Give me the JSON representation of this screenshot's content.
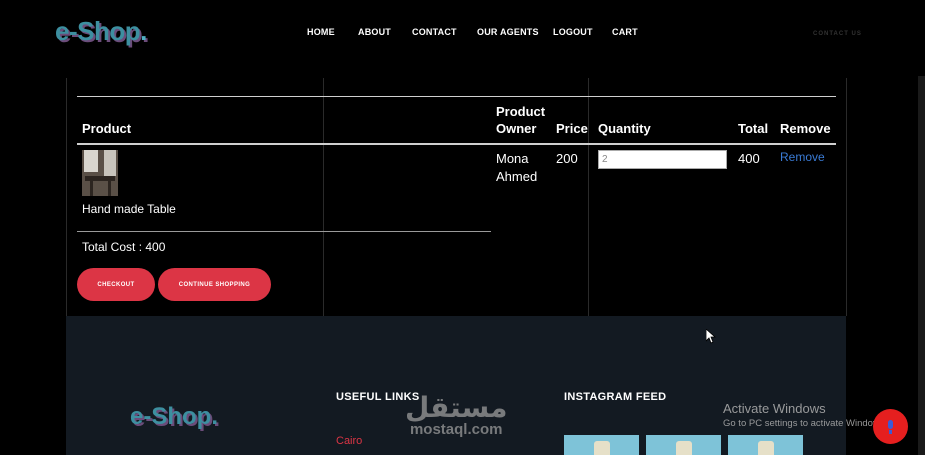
{
  "brand": {
    "logo_text": "e-Shop",
    "logo_dot": "."
  },
  "nav": {
    "items": [
      {
        "label": "HOME"
      },
      {
        "label": "ABOUT"
      },
      {
        "label": "CONTACT"
      },
      {
        "label": "OUR AGENTS"
      },
      {
        "label": "LOGOUT"
      },
      {
        "label": "CART"
      }
    ],
    "contact_us": "CONTACT US"
  },
  "cart": {
    "headers": {
      "product": "Product",
      "owner": "Product Owner",
      "price": "Price",
      "quantity": "Quantity",
      "total": "Total",
      "remove": "Remove"
    },
    "rows": [
      {
        "product_name": "Hand made Table",
        "owner": "Mona Ahmed",
        "price": "200",
        "quantity": "2",
        "total": "400",
        "remove_label": "Remove"
      }
    ],
    "total_cost": "Total Cost : 400",
    "checkout_label": "CHECKOUT",
    "continue_label": "CONTINUE SHOPPING"
  },
  "footer": {
    "logo_text": "e-Shop.",
    "useful_links_title": "USEFUL LINKS",
    "links": [
      "Cairo"
    ],
    "instagram_title": "INSTAGRAM FEED"
  },
  "overlay": {
    "watermark_ar": "مستقل",
    "watermark_lat": "mostaql.com",
    "activate_title": "Activate Windows",
    "activate_sub": "Go to PC settings to activate Windows."
  },
  "colors": {
    "accent": "#dc3545",
    "link": "#3a7bd5",
    "footer_bg": "#131a22",
    "logo": "#3d8fa0"
  }
}
